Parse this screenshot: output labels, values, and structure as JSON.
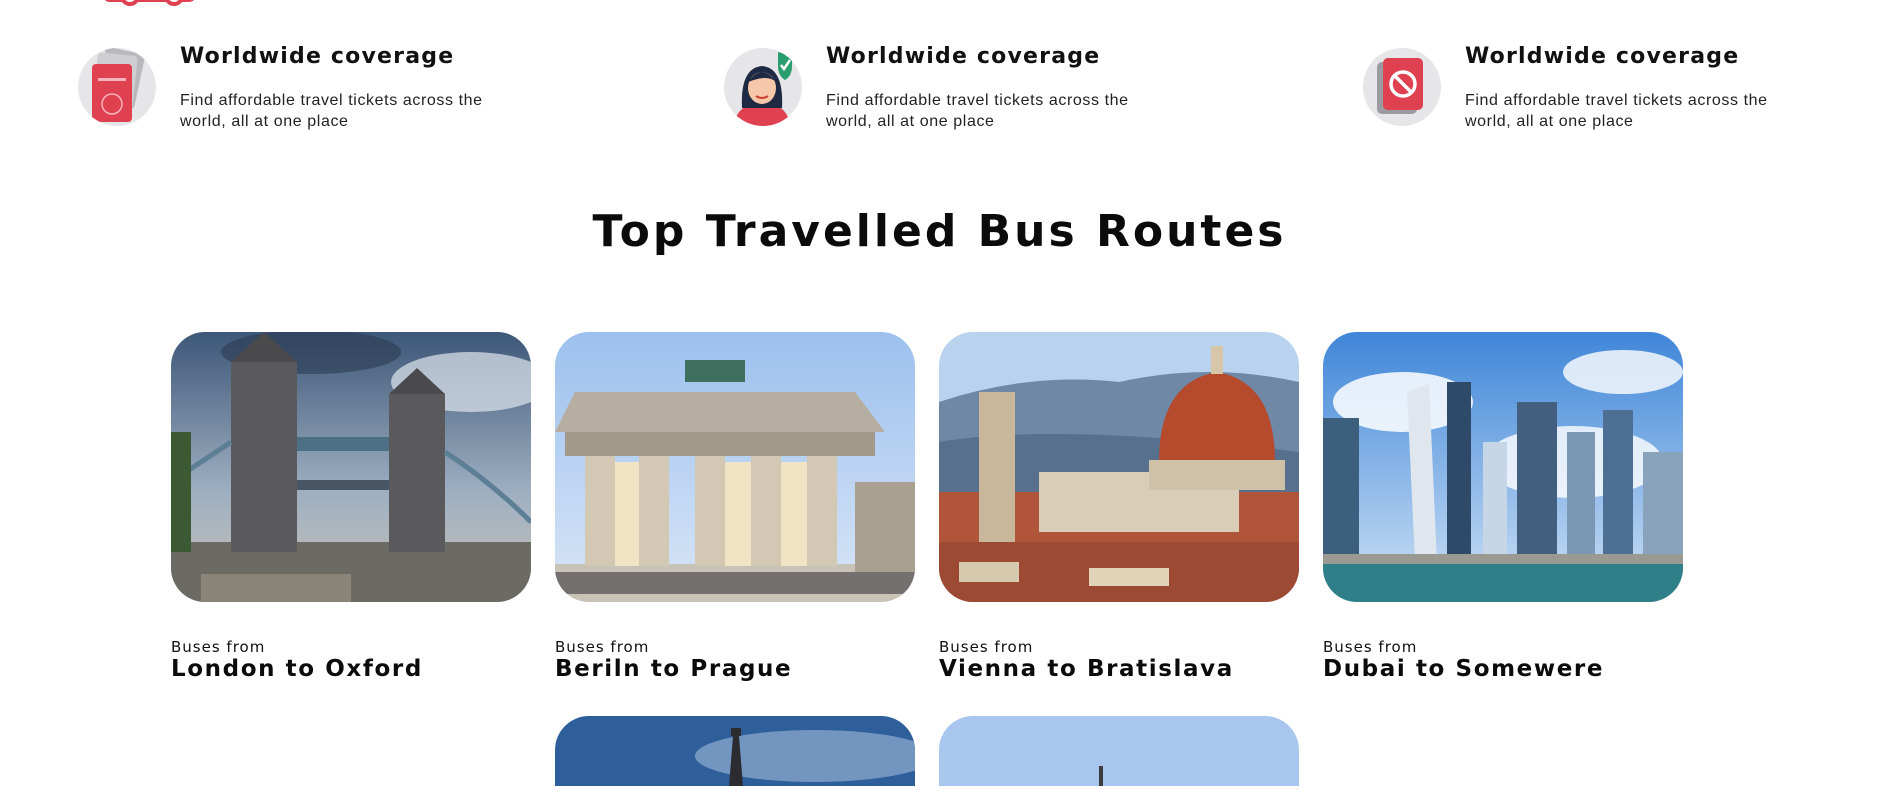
{
  "features": [
    {
      "icon": "passport-icon",
      "title": "Worldwide coverage",
      "description": "Find affordable travel tickets across the world, all at one place"
    },
    {
      "icon": "traveler-shield-icon",
      "title": "Worldwide coverage",
      "description": "Find affordable travel tickets across the world, all at one place"
    },
    {
      "icon": "no-entry-card-icon",
      "title": "Worldwide coverage",
      "description": "Find affordable travel tickets across the world, all at one place"
    }
  ],
  "section": {
    "title": "Top Travelled Bus Routes"
  },
  "routes": [
    {
      "prefix": "Buses from",
      "name": "London to Oxford",
      "image": "tower-bridge-photo"
    },
    {
      "prefix": "Buses from",
      "name": "Beriln to Prague",
      "image": "brandenburg-gate-photo"
    },
    {
      "prefix": "Buses from",
      "name": "Vienna to Bratislava",
      "image": "florence-cathedral-photo"
    },
    {
      "prefix": "Buses from",
      "name": "Dubai to Somewere",
      "image": "dubai-marina-photo"
    },
    {
      "image": "eiffel-tower-photo"
    },
    {
      "image": "city-tower-photo"
    }
  ],
  "colors": {
    "accent": "#e04150",
    "text": "#0b0b0b",
    "icon_bg": "#e6e6e8"
  }
}
